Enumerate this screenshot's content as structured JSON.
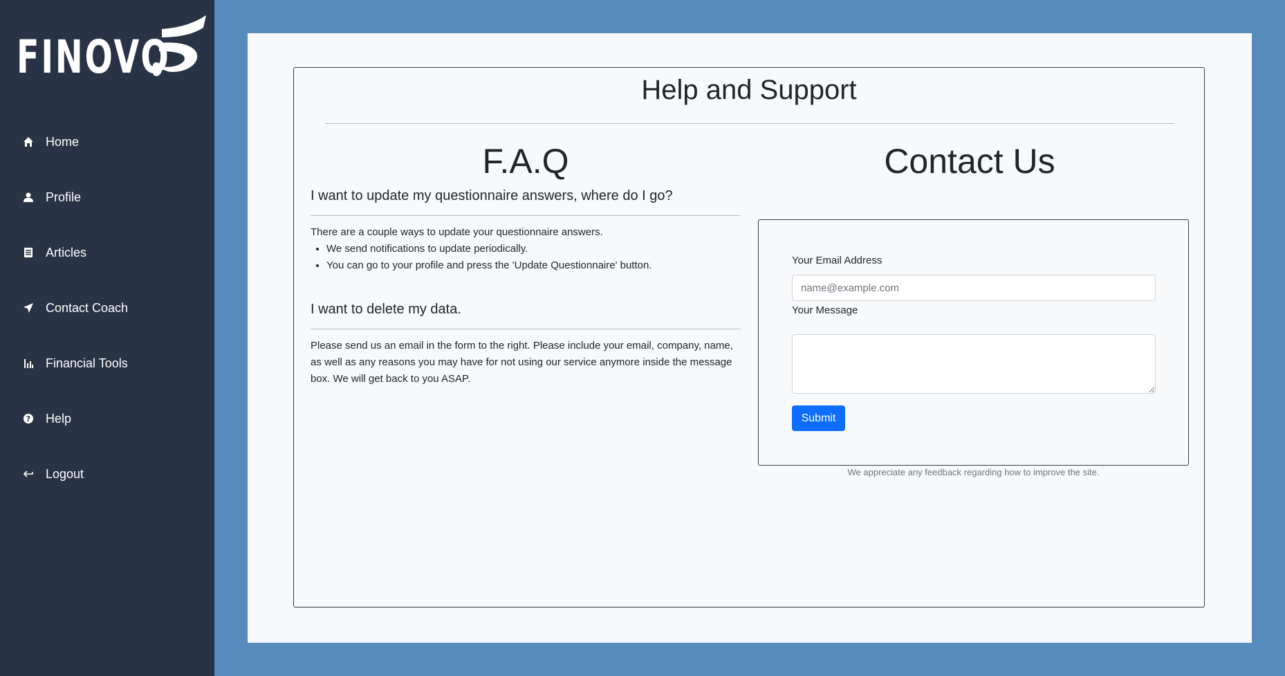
{
  "brand": {
    "name": "FINOVO",
    "logo_icon": "finovo-swirl-logo"
  },
  "sidebar": {
    "items": [
      {
        "label": "Home",
        "icon": "home-icon"
      },
      {
        "label": "Profile",
        "icon": "user-icon"
      },
      {
        "label": "Articles",
        "icon": "newspaper-icon"
      },
      {
        "label": "Contact Coach",
        "icon": "paper-plane-icon"
      },
      {
        "label": "Financial Tools",
        "icon": "bar-chart-icon"
      },
      {
        "label": "Help",
        "icon": "question-circle-icon"
      },
      {
        "label": "Logout",
        "icon": "logout-arrow-icon"
      }
    ]
  },
  "page": {
    "title": "Help and Support"
  },
  "faq": {
    "title": "F.A.Q",
    "q1": {
      "question": "I want to update my questionnaire answers, where do I go?",
      "intro": "There are a couple ways to update your questionnaire answers.",
      "bullets": [
        "We send notifications to update periodically.",
        "You can go to your profile and press the 'Update Questionnaire' button."
      ]
    },
    "q2": {
      "question": "I want to delete my data.",
      "answer": "Please send us an email in the form to the right. Please include your email, company, name, as well as any reasons you may have for not using our service anymore inside the message box. We will get back to you ASAP."
    }
  },
  "contact": {
    "title": "Contact Us",
    "email_label": "Your Email Address",
    "email_value": "",
    "email_placeholder": "name@example.com",
    "message_label": "Your Message",
    "message_value": "",
    "submit_label": "Submit",
    "feedback_note": "We appreciate any feedback regarding how to improve the site."
  },
  "colors": {
    "sidebar_bg": "#283445",
    "page_bg": "#578bbb",
    "panel_bg": "#f8f9fa",
    "primary": "#0d6efd"
  }
}
